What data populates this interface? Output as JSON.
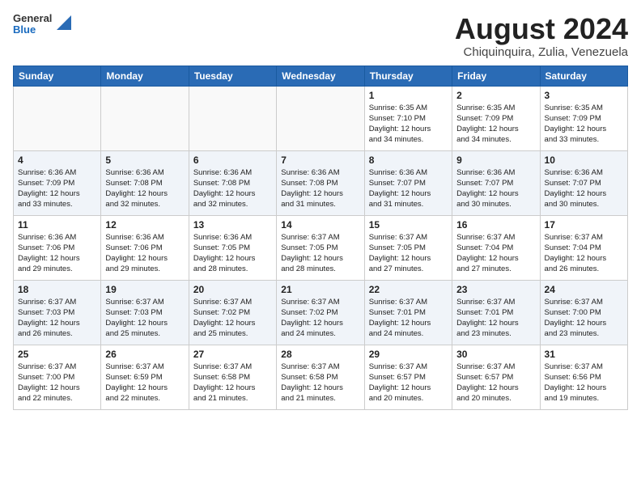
{
  "logo": {
    "general": "General",
    "blue": "Blue"
  },
  "title": "August 2024",
  "location": "Chiquinquira, Zulia, Venezuela",
  "days_header": [
    "Sunday",
    "Monday",
    "Tuesday",
    "Wednesday",
    "Thursday",
    "Friday",
    "Saturday"
  ],
  "weeks": [
    [
      {
        "day": "",
        "info": ""
      },
      {
        "day": "",
        "info": ""
      },
      {
        "day": "",
        "info": ""
      },
      {
        "day": "",
        "info": ""
      },
      {
        "day": "1",
        "info": "Sunrise: 6:35 AM\nSunset: 7:10 PM\nDaylight: 12 hours\nand 34 minutes."
      },
      {
        "day": "2",
        "info": "Sunrise: 6:35 AM\nSunset: 7:09 PM\nDaylight: 12 hours\nand 34 minutes."
      },
      {
        "day": "3",
        "info": "Sunrise: 6:35 AM\nSunset: 7:09 PM\nDaylight: 12 hours\nand 33 minutes."
      }
    ],
    [
      {
        "day": "4",
        "info": "Sunrise: 6:36 AM\nSunset: 7:09 PM\nDaylight: 12 hours\nand 33 minutes."
      },
      {
        "day": "5",
        "info": "Sunrise: 6:36 AM\nSunset: 7:08 PM\nDaylight: 12 hours\nand 32 minutes."
      },
      {
        "day": "6",
        "info": "Sunrise: 6:36 AM\nSunset: 7:08 PM\nDaylight: 12 hours\nand 32 minutes."
      },
      {
        "day": "7",
        "info": "Sunrise: 6:36 AM\nSunset: 7:08 PM\nDaylight: 12 hours\nand 31 minutes."
      },
      {
        "day": "8",
        "info": "Sunrise: 6:36 AM\nSunset: 7:07 PM\nDaylight: 12 hours\nand 31 minutes."
      },
      {
        "day": "9",
        "info": "Sunrise: 6:36 AM\nSunset: 7:07 PM\nDaylight: 12 hours\nand 30 minutes."
      },
      {
        "day": "10",
        "info": "Sunrise: 6:36 AM\nSunset: 7:07 PM\nDaylight: 12 hours\nand 30 minutes."
      }
    ],
    [
      {
        "day": "11",
        "info": "Sunrise: 6:36 AM\nSunset: 7:06 PM\nDaylight: 12 hours\nand 29 minutes."
      },
      {
        "day": "12",
        "info": "Sunrise: 6:36 AM\nSunset: 7:06 PM\nDaylight: 12 hours\nand 29 minutes."
      },
      {
        "day": "13",
        "info": "Sunrise: 6:36 AM\nSunset: 7:05 PM\nDaylight: 12 hours\nand 28 minutes."
      },
      {
        "day": "14",
        "info": "Sunrise: 6:37 AM\nSunset: 7:05 PM\nDaylight: 12 hours\nand 28 minutes."
      },
      {
        "day": "15",
        "info": "Sunrise: 6:37 AM\nSunset: 7:05 PM\nDaylight: 12 hours\nand 27 minutes."
      },
      {
        "day": "16",
        "info": "Sunrise: 6:37 AM\nSunset: 7:04 PM\nDaylight: 12 hours\nand 27 minutes."
      },
      {
        "day": "17",
        "info": "Sunrise: 6:37 AM\nSunset: 7:04 PM\nDaylight: 12 hours\nand 26 minutes."
      }
    ],
    [
      {
        "day": "18",
        "info": "Sunrise: 6:37 AM\nSunset: 7:03 PM\nDaylight: 12 hours\nand 26 minutes."
      },
      {
        "day": "19",
        "info": "Sunrise: 6:37 AM\nSunset: 7:03 PM\nDaylight: 12 hours\nand 25 minutes."
      },
      {
        "day": "20",
        "info": "Sunrise: 6:37 AM\nSunset: 7:02 PM\nDaylight: 12 hours\nand 25 minutes."
      },
      {
        "day": "21",
        "info": "Sunrise: 6:37 AM\nSunset: 7:02 PM\nDaylight: 12 hours\nand 24 minutes."
      },
      {
        "day": "22",
        "info": "Sunrise: 6:37 AM\nSunset: 7:01 PM\nDaylight: 12 hours\nand 24 minutes."
      },
      {
        "day": "23",
        "info": "Sunrise: 6:37 AM\nSunset: 7:01 PM\nDaylight: 12 hours\nand 23 minutes."
      },
      {
        "day": "24",
        "info": "Sunrise: 6:37 AM\nSunset: 7:00 PM\nDaylight: 12 hours\nand 23 minutes."
      }
    ],
    [
      {
        "day": "25",
        "info": "Sunrise: 6:37 AM\nSunset: 7:00 PM\nDaylight: 12 hours\nand 22 minutes."
      },
      {
        "day": "26",
        "info": "Sunrise: 6:37 AM\nSunset: 6:59 PM\nDaylight: 12 hours\nand 22 minutes."
      },
      {
        "day": "27",
        "info": "Sunrise: 6:37 AM\nSunset: 6:58 PM\nDaylight: 12 hours\nand 21 minutes."
      },
      {
        "day": "28",
        "info": "Sunrise: 6:37 AM\nSunset: 6:58 PM\nDaylight: 12 hours\nand 21 minutes."
      },
      {
        "day": "29",
        "info": "Sunrise: 6:37 AM\nSunset: 6:57 PM\nDaylight: 12 hours\nand 20 minutes."
      },
      {
        "day": "30",
        "info": "Sunrise: 6:37 AM\nSunset: 6:57 PM\nDaylight: 12 hours\nand 20 minutes."
      },
      {
        "day": "31",
        "info": "Sunrise: 6:37 AM\nSunset: 6:56 PM\nDaylight: 12 hours\nand 19 minutes."
      }
    ]
  ]
}
